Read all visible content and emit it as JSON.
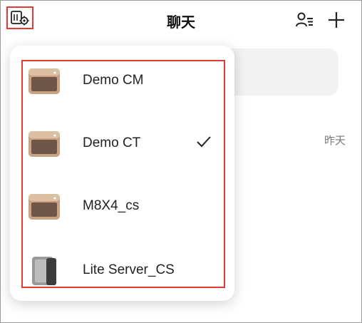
{
  "header": {
    "title": "聊天",
    "settings_icon": "nas-settings-icon",
    "contacts_icon": "contacts-icon",
    "add_icon": "plus-icon"
  },
  "chat_list": {
    "time": "昨天"
  },
  "server_menu": {
    "selected": "Demo CT",
    "items": [
      {
        "name": "Demo CM",
        "icon": "nas-gold-icon",
        "selected": false
      },
      {
        "name": "Demo CT",
        "icon": "nas-gold-icon",
        "selected": true
      },
      {
        "name": "M8X4_cs",
        "icon": "nas-gold-icon",
        "selected": false
      },
      {
        "name": "Lite Server_CS",
        "icon": "nas-lite-icon",
        "selected": false
      }
    ]
  },
  "colors": {
    "highlight": "#e53935",
    "accent_text": "#111111"
  }
}
